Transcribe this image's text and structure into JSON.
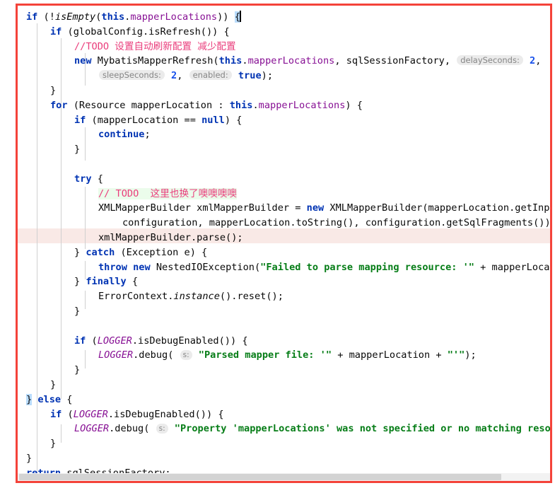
{
  "editor": {
    "app": "IntelliJ IDEA code editor",
    "language": "Java",
    "font_size_px": 13.6,
    "line_height_px": 21,
    "colors": {
      "selection_frame": "#f4433a",
      "caret_row_background": "#fffae4",
      "removed_row_background": "#f9e9e6",
      "todo_changed_background": "#ebfceb",
      "brace_match_background": "#b9dcfc",
      "keyword": "#0033b3",
      "string": "#067d17",
      "number": "#1750eb",
      "field": "#871094",
      "todo_comment": "#ea3e7c",
      "comment": "#8c8c8c",
      "inlay_hint_background": "#ebebeb",
      "inlay_hint_text": "#868686",
      "indent_guide": "#d0d0d0",
      "scrollbar_track": "#f2f2f2",
      "scrollbar_thumb": "#d3d3d3",
      "text": "#080808"
    }
  },
  "code": {
    "lines": [
      {
        "n": 1,
        "indent": 0,
        "bg": "caret",
        "text": "if (!isEmpty(this.mapperLocations)) {"
      },
      {
        "n": 2,
        "indent": 1,
        "bg": "none",
        "text": "if (globalConfig.isRefresh()) {"
      },
      {
        "n": 3,
        "indent": 2,
        "bg": "none",
        "text": "//TODO 设置自动刷新配置 减少配置"
      },
      {
        "n": 4,
        "indent": 2,
        "bg": "none",
        "text": "new MybatisMapperRefresh(this.mapperLocations, sqlSessionFactory, delaySeconds: 2,"
      },
      {
        "n": 5,
        "indent": 3,
        "bg": "none",
        "text": "sleepSeconds: 2, enabled: true);"
      },
      {
        "n": 6,
        "indent": 1,
        "bg": "none",
        "text": "}"
      },
      {
        "n": 7,
        "indent": 1,
        "bg": "none",
        "text": "for (Resource mapperLocation : this.mapperLocations) {"
      },
      {
        "n": 8,
        "indent": 2,
        "bg": "none",
        "text": "if (mapperLocation == null) {"
      },
      {
        "n": 9,
        "indent": 3,
        "bg": "none",
        "text": "continue;"
      },
      {
        "n": 10,
        "indent": 2,
        "bg": "none",
        "text": "}"
      },
      {
        "n": 11,
        "indent": 0,
        "bg": "none",
        "text": ""
      },
      {
        "n": 12,
        "indent": 2,
        "bg": "none",
        "text": "try {"
      },
      {
        "n": 13,
        "indent": 3,
        "bg": "none",
        "text": "// TODO  这里也换了噢噢噢噢"
      },
      {
        "n": 14,
        "indent": 3,
        "bg": "none",
        "text": "XMLMapperBuilder xmlMapperBuilder = new XMLMapperBuilder(mapperLocation.getInputStream(),"
      },
      {
        "n": 15,
        "indent": 4,
        "bg": "none",
        "text": "configuration, mapperLocation.toString(), configuration.getSqlFragments());"
      },
      {
        "n": 16,
        "indent": 3,
        "bg": "removed",
        "text": "xmlMapperBuilder.parse();"
      },
      {
        "n": 17,
        "indent": 2,
        "bg": "none",
        "text": "} catch (Exception e) {"
      },
      {
        "n": 18,
        "indent": 3,
        "bg": "none",
        "text": "throw new NestedIOException(\"Failed to parse mapping resource: '\" + mapperLocation + \"'\", e);"
      },
      {
        "n": 19,
        "indent": 2,
        "bg": "none",
        "text": "} finally {"
      },
      {
        "n": 20,
        "indent": 3,
        "bg": "none",
        "text": "ErrorContext.instance().reset();"
      },
      {
        "n": 21,
        "indent": 2,
        "bg": "none",
        "text": "}"
      },
      {
        "n": 22,
        "indent": 0,
        "bg": "none",
        "text": ""
      },
      {
        "n": 23,
        "indent": 2,
        "bg": "none",
        "text": "if (LOGGER.isDebugEnabled()) {"
      },
      {
        "n": 24,
        "indent": 3,
        "bg": "none",
        "text": "LOGGER.debug( s: \"Parsed mapper file: '\" + mapperLocation + \"'\");"
      },
      {
        "n": 25,
        "indent": 2,
        "bg": "none",
        "text": "}"
      },
      {
        "n": 26,
        "indent": 1,
        "bg": "none",
        "text": "}"
      },
      {
        "n": 27,
        "indent": 0,
        "bg": "none",
        "text": "} else {"
      },
      {
        "n": 28,
        "indent": 1,
        "bg": "none",
        "text": "if (LOGGER.isDebugEnabled()) {"
      },
      {
        "n": 29,
        "indent": 2,
        "bg": "none",
        "text": "LOGGER.debug( s: \"Property 'mapperLocations' was not specified or no matching resources found\");"
      },
      {
        "n": 30,
        "indent": 1,
        "bg": "none",
        "text": "}"
      },
      {
        "n": 31,
        "indent": 0,
        "bg": "none",
        "text": "}"
      },
      {
        "n": 32,
        "indent": 0,
        "bg": "none",
        "text": "return sqlSessionFactory;"
      }
    ]
  },
  "inlay_hints": [
    {
      "label": "delaySeconds:",
      "value": "2",
      "line": 4
    },
    {
      "label": "sleepSeconds:",
      "value": "2",
      "line": 5
    },
    {
      "label": "enabled:",
      "value": "true",
      "line": 5
    },
    {
      "label": "s:",
      "value": "\"Parsed mapper file: '\"",
      "line": 24
    },
    {
      "label": "s:",
      "value": "\"Property 'mapperLocations' was not specified or no matching resources found\"",
      "line": 29
    }
  ],
  "scrollbar": {
    "orientation": "horizontal",
    "thumb_fraction": 0.91
  }
}
